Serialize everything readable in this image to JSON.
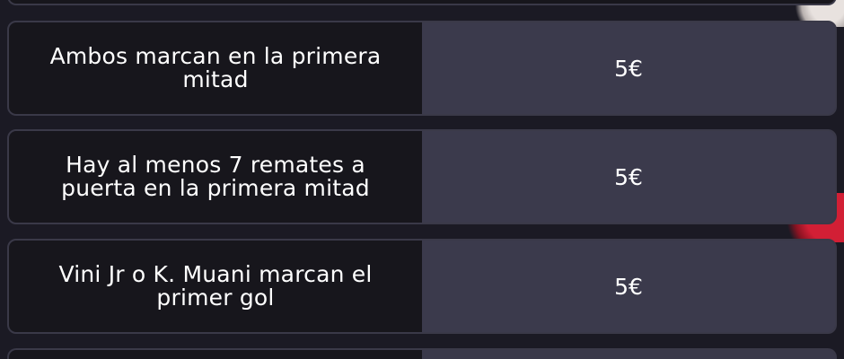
{
  "bets": [
    {
      "question": "Ambos marcan en la primera mitad",
      "stake": "5€"
    },
    {
      "question": "Hay al menos 7 remates a puerta en la primera mitad",
      "stake": "5€"
    },
    {
      "question": "Vini Jr o K. Muani marcan el primer gol",
      "stake": "5€"
    }
  ],
  "colors": {
    "background": "#1b1a24",
    "question_panel": "#17161c",
    "stake_panel": "#3b3a4c",
    "text": "#ffffff"
  }
}
